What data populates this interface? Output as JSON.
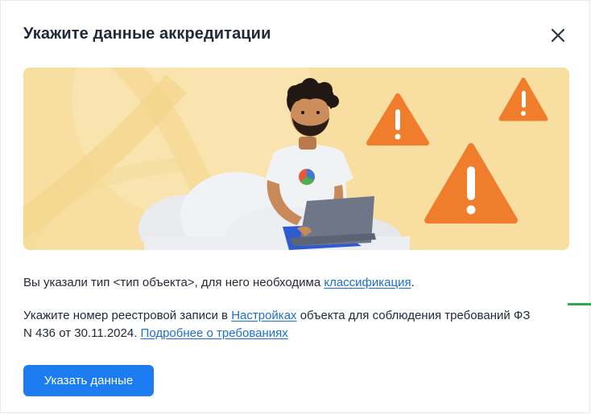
{
  "dialog": {
    "title": "Укажите данные аккредитации",
    "close_icon": "close-icon"
  },
  "banner": {
    "illustration": "person-with-laptop-and-warning-signs",
    "colors": {
      "background": "#f8dfa1",
      "warning": "#ef7d2b",
      "shirt": "#f1f2f4",
      "laptop": "#6f7688"
    }
  },
  "message": {
    "line1_prefix": "Вы указали тип <тип объекта>, для него необходима ",
    "line1_link": "классификация",
    "line1_suffix": ".",
    "line2_prefix": "Укажите номер реестровой записи в ",
    "line2_link_settings": "Настройках",
    "line2_middle": " объекта для соблюдения требований ФЗ N 436 от 30.11.2024. ",
    "line2_link_more": "Подробнее о требованиях"
  },
  "actions": {
    "submit_label": "Указать данные"
  },
  "colors": {
    "accent": "#1c7cf0",
    "link": "#1a6fd6",
    "text": "#1f2937"
  }
}
